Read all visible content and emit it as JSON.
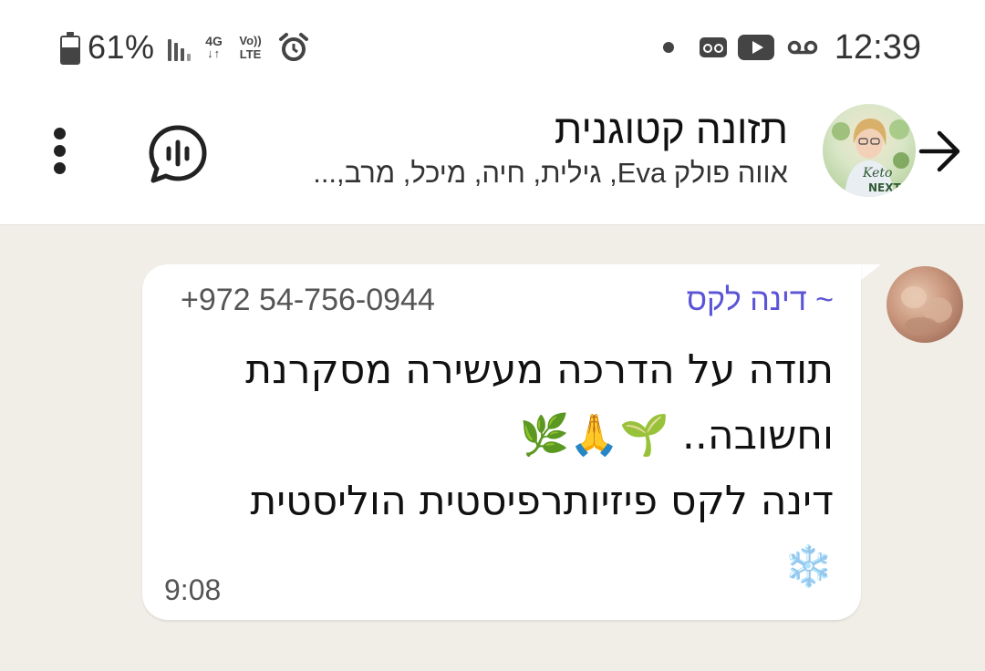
{
  "status_bar": {
    "battery_percent_label": "61%",
    "battery_level": 0.61,
    "network_label": "4G",
    "volte_label_top": "Vo))",
    "volte_label_bottom": "LTE",
    "time": "12:39",
    "icons": [
      "battery-icon",
      "signal-icon",
      "network-4g-icon",
      "volte-icon",
      "alarm-icon",
      "notification-dot-icon",
      "voicemail-icon",
      "youtube-icon",
      "voicemail-tape-icon"
    ]
  },
  "header": {
    "title": "תזונה קטוגנית",
    "members": "אווה פולק Eva, גילית, חיה, מיכל, מרב,...",
    "avatar_text_top": "Keto",
    "avatar_text_bottom": "NEXT",
    "icons": [
      "back-arrow-icon",
      "voice-chat-icon",
      "more-options-icon"
    ]
  },
  "message": {
    "sender_name": "~ דינה לקס",
    "sender_phone": "+972 54-756-0944",
    "lines": [
      "תודה על הדרכה מעשירה מסקרנת",
      "וחשובה.. 🌱🙏🌿",
      "דינה לקס פיזיותרפיסטית הוליסטית",
      "❄️"
    ],
    "time": "9:08"
  }
}
